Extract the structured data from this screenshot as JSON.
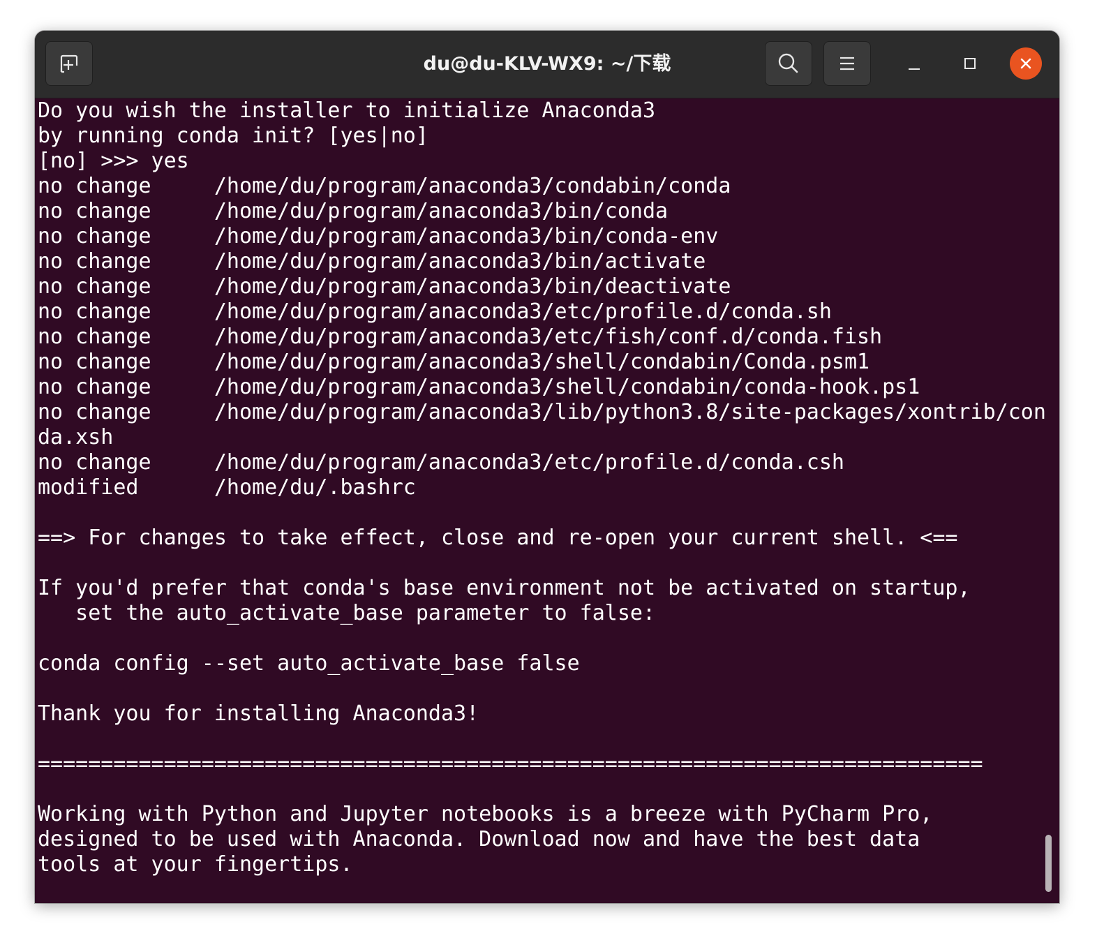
{
  "window": {
    "title": "du@du-KLV-WX9: ~/下载",
    "accent_close": "#e95420",
    "terminal_bg": "#300a24"
  },
  "titlebar": {
    "new_tab_icon": "new-tab-icon",
    "search_icon": "search-icon",
    "menu_icon": "hamburger-menu-icon",
    "minimize_icon": "minimize-icon",
    "maximize_icon": "maximize-icon",
    "close_icon": "close-icon"
  },
  "terminal": {
    "lines": [
      "Do you wish the installer to initialize Anaconda3",
      "by running conda init? [yes|no]",
      "[no] >>> yes",
      "no change     /home/du/program/anaconda3/condabin/conda",
      "no change     /home/du/program/anaconda3/bin/conda",
      "no change     /home/du/program/anaconda3/bin/conda-env",
      "no change     /home/du/program/anaconda3/bin/activate",
      "no change     /home/du/program/anaconda3/bin/deactivate",
      "no change     /home/du/program/anaconda3/etc/profile.d/conda.sh",
      "no change     /home/du/program/anaconda3/etc/fish/conf.d/conda.fish",
      "no change     /home/du/program/anaconda3/shell/condabin/Conda.psm1",
      "no change     /home/du/program/anaconda3/shell/condabin/conda-hook.ps1",
      "no change     /home/du/program/anaconda3/lib/python3.8/site-packages/xontrib/con",
      "da.xsh",
      "no change     /home/du/program/anaconda3/etc/profile.d/conda.csh",
      "modified      /home/du/.bashrc",
      "",
      "==> For changes to take effect, close and re-open your current shell. <==",
      "",
      "If you'd prefer that conda's base environment not be activated on startup,",
      "   set the auto_activate_base parameter to false:",
      "",
      "conda config --set auto_activate_base false",
      "",
      "Thank you for installing Anaconda3!",
      "",
      "===========================================================================",
      "",
      "Working with Python and Jupyter notebooks is a breeze with PyCharm Pro,",
      "designed to be used with Anaconda. Download now and have the best data",
      "tools at your fingertips."
    ]
  }
}
